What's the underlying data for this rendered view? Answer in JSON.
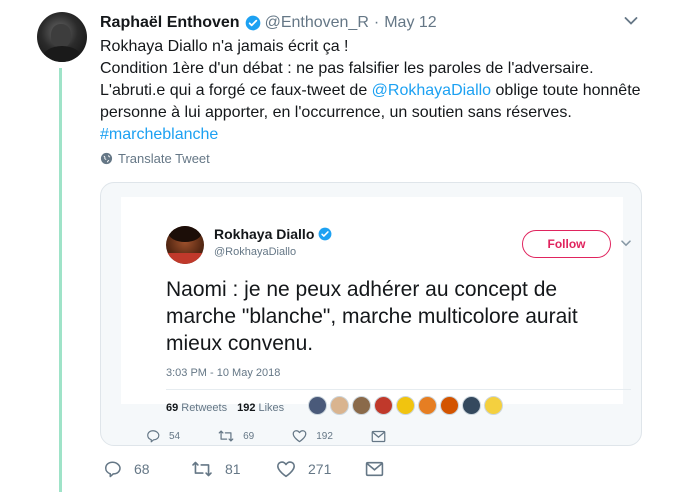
{
  "tweet": {
    "author_name": "Raphaël Enthoven",
    "handle": "@Enthoven_R",
    "separator": "·",
    "date": "May 12",
    "text_lines": [
      "Rokhaya Diallo n'a jamais écrit ça !",
      "Condition 1ère d'un débat : ne pas falsifier les paroles de l'adversaire.",
      "L'abruti.e qui a forgé ce faux-tweet de ",
      "@RokhayaDiallo",
      " oblige toute honnête",
      "personne à lui apporter, en l'occurrence, un soutien sans réserves.",
      "#marcheblanche"
    ],
    "translate_label": "Translate Tweet",
    "actions": {
      "replies": "68",
      "retweets": "81",
      "likes": "271"
    }
  },
  "embedded": {
    "author_name": "Rokhaya Diallo",
    "handle": "@RokhayaDiallo",
    "follow_label": "Follow",
    "text_lines": [
      "Naomi : je ne peux adhérer au concept de",
      "marche \"blanche\", marche multicolore aurait",
      "mieux convenu."
    ],
    "timestamp": "3:03 PM - 10 May 2018",
    "retweets_count": "69",
    "retweets_label": "Retweets",
    "likes_count": "192",
    "likes_label": "Likes",
    "liker_colors": [
      "#4a5a7a",
      "#d9b48f",
      "#8a6a4a",
      "#c0392b",
      "#f1c40f",
      "#e67e22",
      "#d35400",
      "#34495e",
      "#f4d03f"
    ],
    "actions": {
      "replies": "54",
      "retweets": "69",
      "likes": "192"
    }
  },
  "colors": {
    "link": "#1da1f2",
    "follow": "#e0245e",
    "thread": "#9fe3c8",
    "muted": "#657786"
  }
}
